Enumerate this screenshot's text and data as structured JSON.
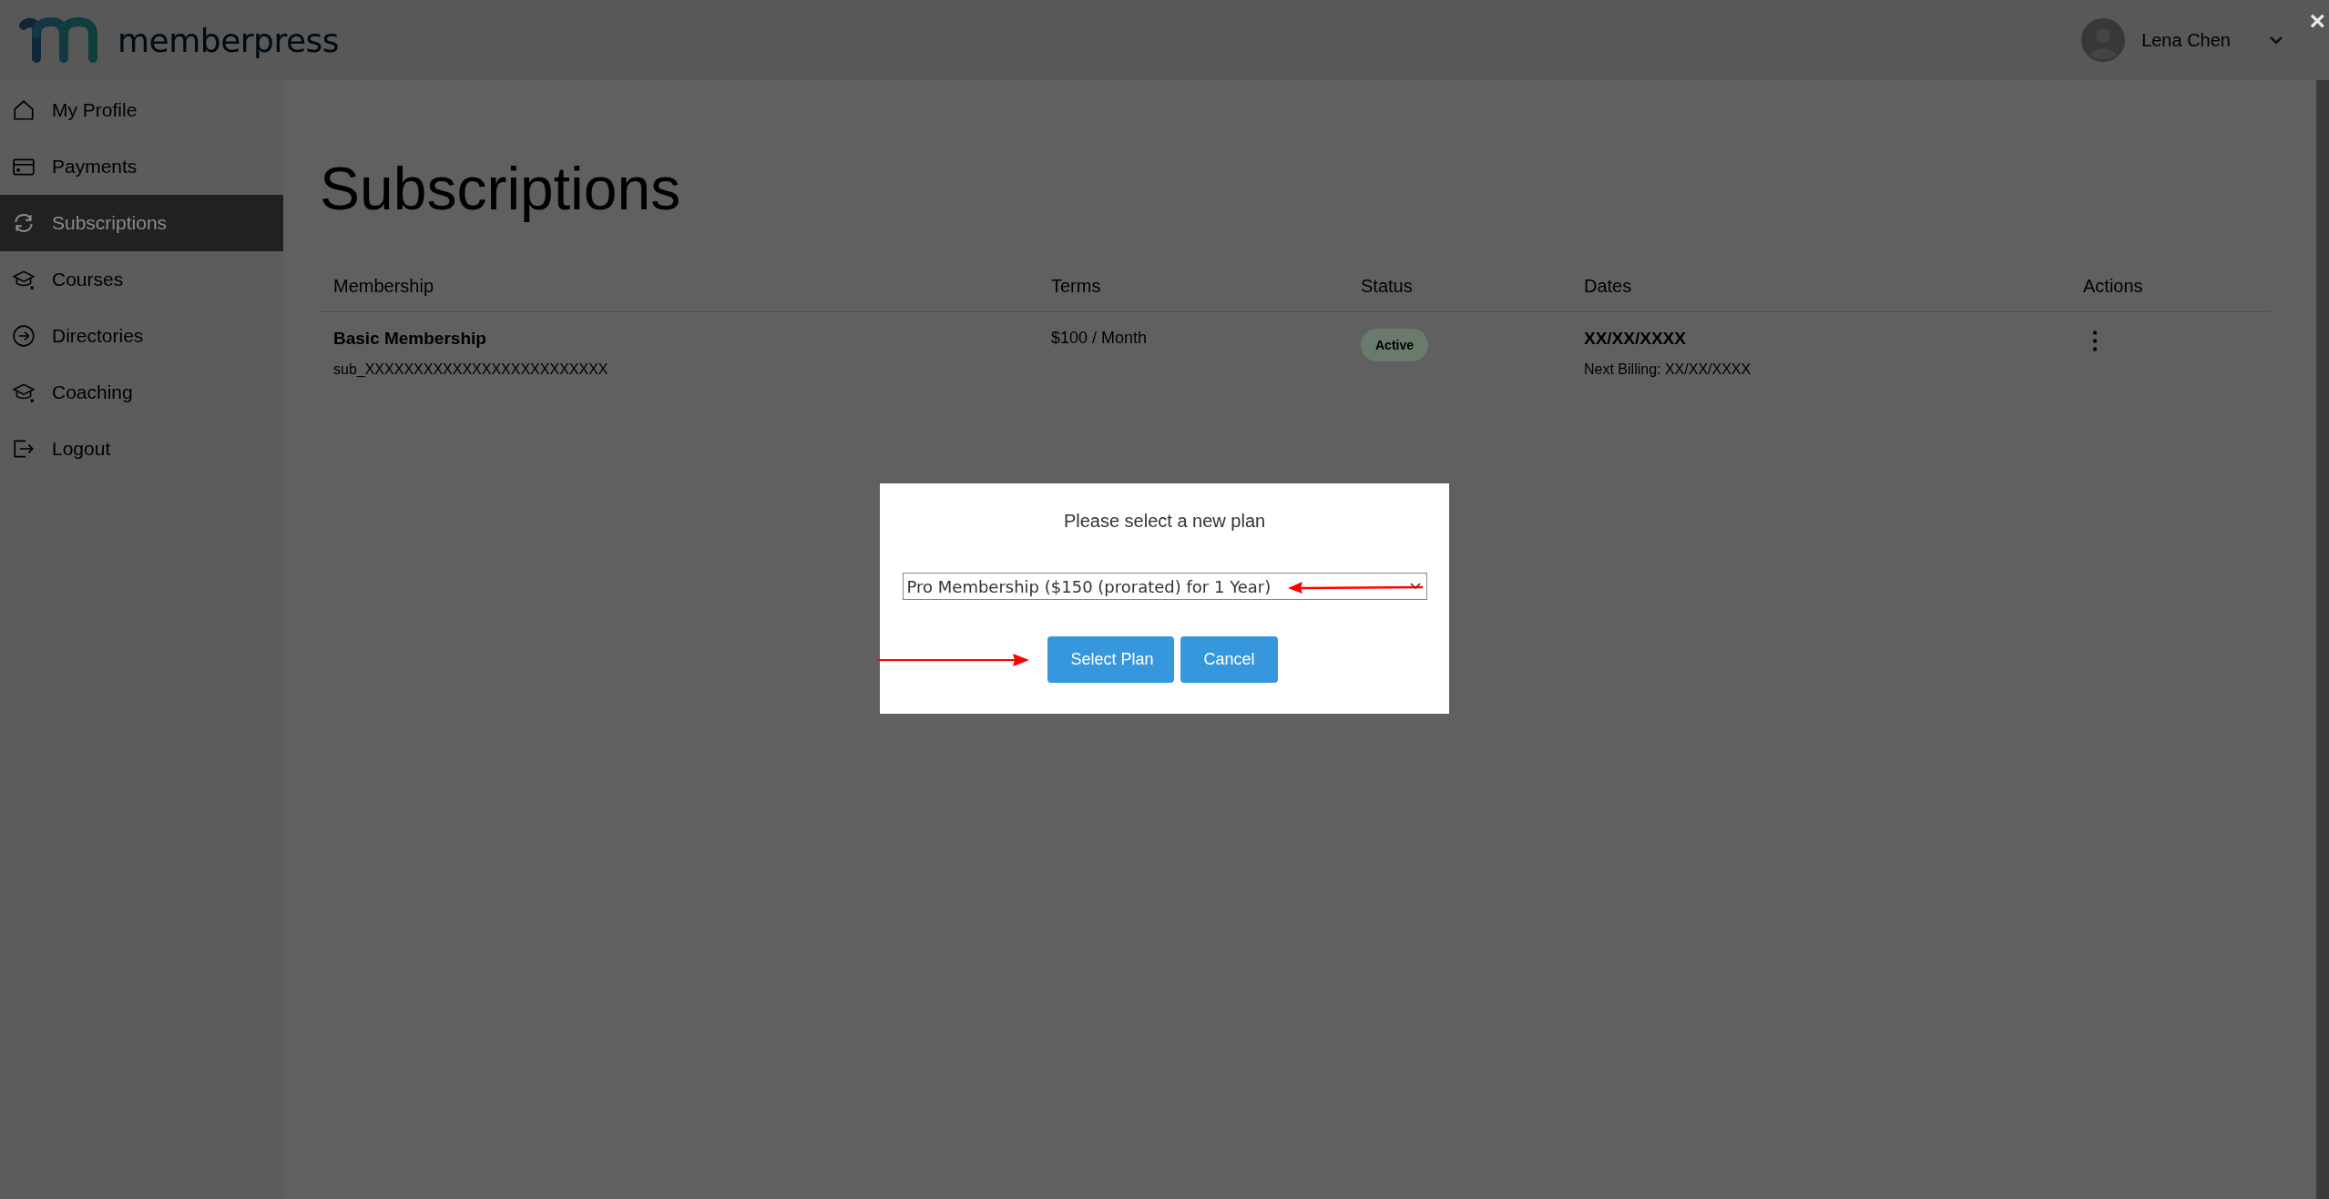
{
  "header": {
    "logo_text": "memberpress",
    "user_name": "Lena Chen",
    "close": "×"
  },
  "sidebar": {
    "items": [
      {
        "label": "My Profile",
        "selected": false
      },
      {
        "label": "Payments",
        "selected": false
      },
      {
        "label": "Subscriptions",
        "selected": true
      },
      {
        "label": "Courses",
        "selected": false
      },
      {
        "label": "Directories",
        "selected": false
      },
      {
        "label": "Coaching",
        "selected": false
      },
      {
        "label": "Logout",
        "selected": false
      }
    ]
  },
  "page_title": "Subscriptions",
  "table": {
    "columns": [
      "Membership",
      "Terms",
      "Status",
      "Dates",
      "Actions"
    ],
    "rows": [
      {
        "membership": "Basic Membership",
        "subscription_id": "sub_XXXXXXXXXXXXXXXXXXXXXXXXX",
        "terms": "$100 / Month",
        "status": "Active",
        "date": "XX/XX/XXXX",
        "next_billing": "Next Billing: XX/XX/XXXX",
        "actions": "⋮"
      }
    ]
  },
  "modal": {
    "title": "Please select a new plan",
    "plan_select": {
      "value": "Pro Membership ($150 (prorated) for 1 Year)"
    },
    "buttons": [
      "Select Plan",
      "Cancel"
    ]
  }
}
